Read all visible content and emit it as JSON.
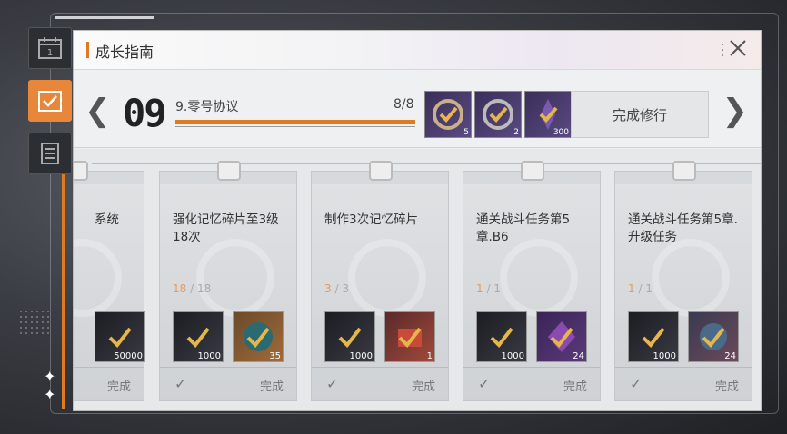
{
  "colors": {
    "accent": "#e07a22",
    "gold_check": "#e5b74a"
  },
  "side_tabs": [
    {
      "icon": "calendar-icon",
      "label": "1"
    },
    {
      "icon": "checklist-icon"
    },
    {
      "icon": "document-icon"
    }
  ],
  "panel": {
    "title": "成长指南"
  },
  "stage": {
    "number": "09",
    "title": "9.零号协议",
    "count": "8/8",
    "progress": 1.0,
    "rewards": [
      {
        "icon": "badge-reward-icon",
        "count": "5"
      },
      {
        "icon": "badge-reward-icon",
        "count": "2"
      },
      {
        "icon": "crystal-reward-icon",
        "count": "300"
      }
    ],
    "complete_label": "完成修行"
  },
  "cards": [
    {
      "title": "系统",
      "progress_value": "",
      "progress_total": "",
      "rewards": [
        {
          "icon": "material-icon",
          "count": "50000"
        }
      ],
      "done": "完成"
    },
    {
      "title": "强化记忆碎片至3级18次",
      "progress_value": "18",
      "progress_total": "18",
      "rewards": [
        {
          "icon": "material-icon",
          "count": "1000"
        },
        {
          "icon": "memory-chip-icon",
          "count": "35"
        }
      ],
      "done": "完成"
    },
    {
      "title": "制作3次记忆碎片",
      "progress_value": "3",
      "progress_total": "3",
      "rewards": [
        {
          "icon": "material-icon",
          "count": "1000"
        },
        {
          "icon": "box-icon",
          "count": "1"
        }
      ],
      "done": "完成"
    },
    {
      "title": "通关战斗任务第5章.B6",
      "progress_value": "1",
      "progress_total": "1",
      "rewards": [
        {
          "icon": "material-icon",
          "count": "1000"
        },
        {
          "icon": "chip-icon",
          "count": "24"
        }
      ],
      "done": "完成"
    },
    {
      "title": "通关战斗任务第5章.升级任务",
      "progress_value": "1",
      "progress_total": "1",
      "rewards": [
        {
          "icon": "material-icon",
          "count": "1000"
        },
        {
          "icon": "chip-icon",
          "count": "24"
        }
      ],
      "done": "完成"
    }
  ]
}
